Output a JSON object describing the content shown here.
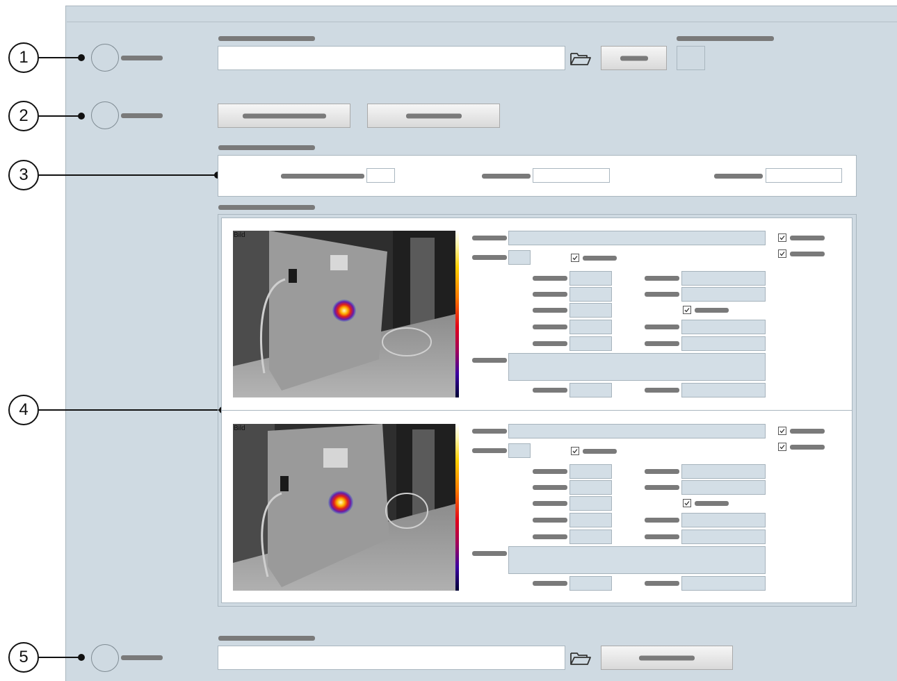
{
  "callouts": [
    "1",
    "2",
    "3",
    "4",
    "5"
  ],
  "analysis_rows": [
    {
      "image_label": "Bild"
    },
    {
      "image_label": "Bild"
    }
  ],
  "icons": {
    "folder": "folder-open-icon",
    "checkbox": "checkbox-checked-icon"
  },
  "colors": {
    "panel": "#cfdae2",
    "placeholder_bar": "#7a7a7a",
    "field_bg": "#ffffff",
    "readonly_field_bg": "#d3dee6"
  }
}
